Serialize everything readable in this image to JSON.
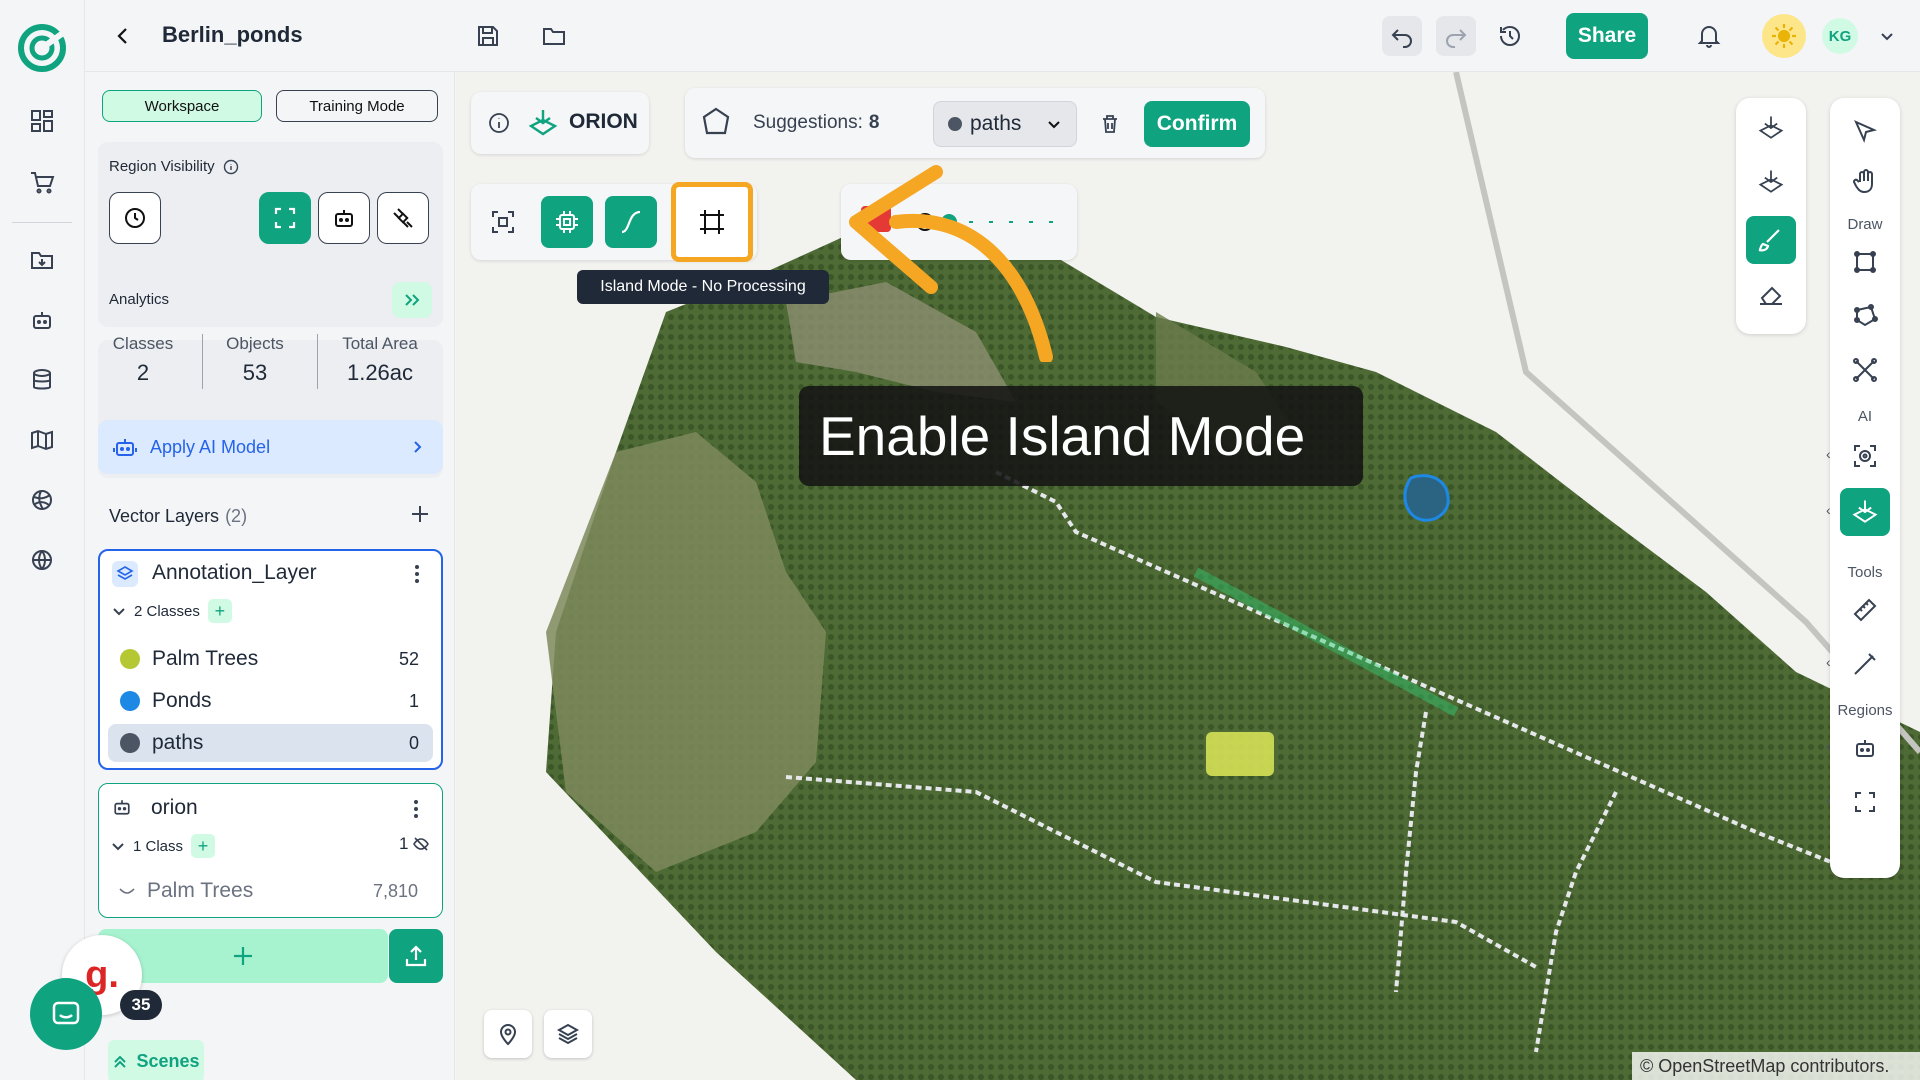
{
  "header": {
    "title": "Berlin_ponds",
    "share_label": "Share",
    "avatar_initials": "KG"
  },
  "sidebar": {
    "mode_workspace": "Workspace",
    "mode_training": "Training Mode",
    "region_visibility_label": "Region Visibility",
    "analytics": {
      "title": "Analytics",
      "classes_label": "Classes",
      "classes_value": "2",
      "objects_label": "Objects",
      "objects_value": "53",
      "area_label": "Total Area",
      "area_value": "1.26ac"
    },
    "apply_ai_label": "Apply AI Model",
    "vector_layers_label": "Vector Layers",
    "vector_layers_count": "(2)",
    "layers": [
      {
        "name": "Annotation_Layer",
        "classes_label": "2 Classes",
        "classes": [
          {
            "name": "Palm Trees",
            "count": "52",
            "color": "#b5c834"
          },
          {
            "name": "Ponds",
            "count": "1",
            "color": "#1e88e5"
          },
          {
            "name": "paths",
            "count": "0",
            "color": "#4b5563"
          }
        ]
      },
      {
        "name": "orion",
        "classes_label": "1 Class",
        "hidden_count": "1",
        "classes": [
          {
            "name": "Palm Trees",
            "count": "7,810"
          }
        ]
      }
    ],
    "badge_count": "35",
    "scenes_label": "Scenes"
  },
  "toolbar": {
    "orion_label": "ORION",
    "suggestions_label": "Suggestions:",
    "suggestions_value": "8",
    "class_select": "paths",
    "confirm_label": "Confirm",
    "tooltip": "Island Mode - No Processing"
  },
  "annotation": {
    "callout_text": "Enable Island Mode"
  },
  "rightbar": {
    "draw_label": "Draw",
    "ai_label": "AI",
    "tools_label": "Tools",
    "regions_label": "Regions"
  },
  "map": {
    "attribution": "© OpenStreetMap contributors."
  },
  "colors": {
    "accent": "#10a37f",
    "highlight": "#f5a623",
    "selected_border": "#2563eb"
  }
}
